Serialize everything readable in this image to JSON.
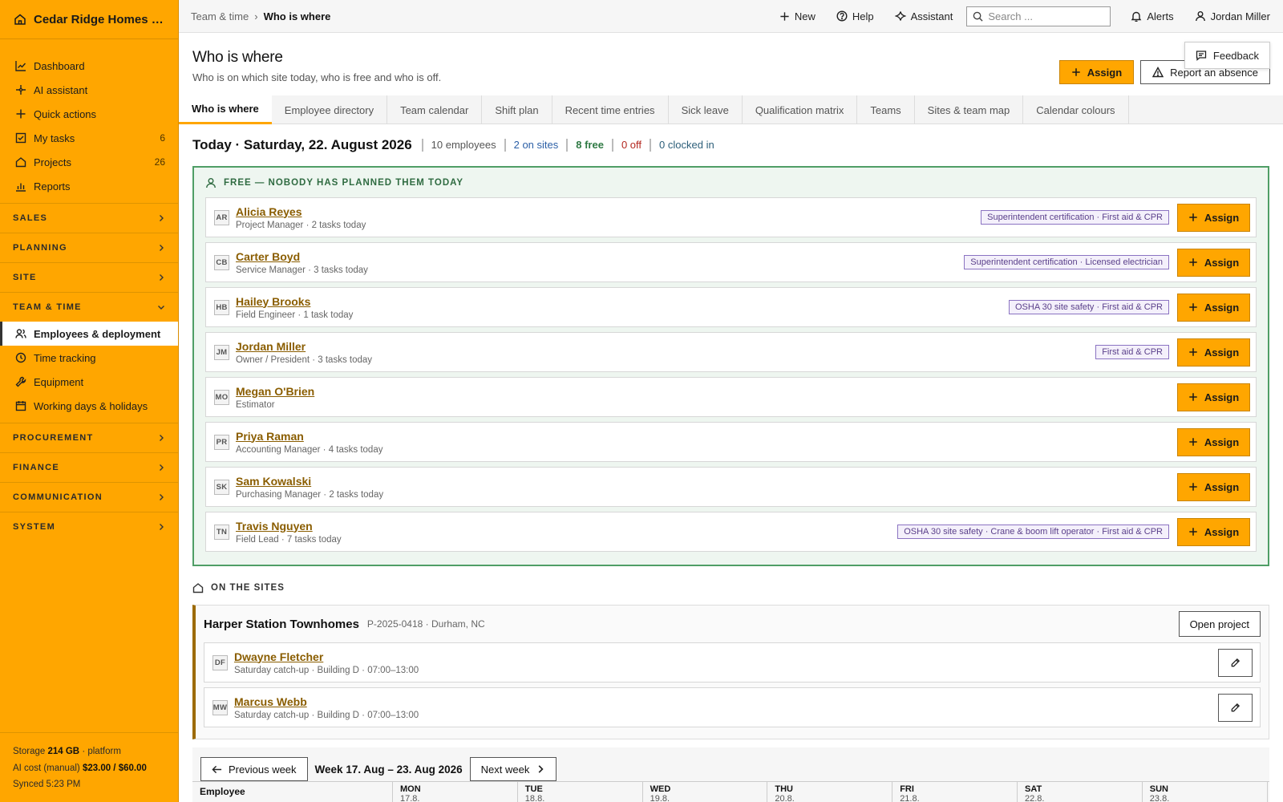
{
  "sidebar": {
    "brand": "Cedar Ridge Homes LLC",
    "items": [
      {
        "label": "Dashboard",
        "icon": "chart-line-icon"
      },
      {
        "label": "AI assistant",
        "icon": "sparkle-icon"
      },
      {
        "label": "Quick actions",
        "icon": "plus-icon"
      },
      {
        "label": "My tasks",
        "icon": "checkbox-icon",
        "count": "6"
      },
      {
        "label": "Projects",
        "icon": "home-icon",
        "count": "26"
      },
      {
        "label": "Reports",
        "icon": "bar-chart-icon"
      }
    ],
    "sections_top": [
      "SALES",
      "PLANNING",
      "SITE"
    ],
    "team_section": "TEAM & TIME",
    "team_items": [
      {
        "label": "Employees & deployment",
        "icon": "users-icon",
        "active": true
      },
      {
        "label": "Time tracking",
        "icon": "clock-icon"
      },
      {
        "label": "Equipment",
        "icon": "wrench-icon"
      },
      {
        "label": "Working days & holidays",
        "icon": "calendar-icon"
      }
    ],
    "sections_bottom": [
      "PROCUREMENT",
      "FINANCE",
      "COMMUNICATION",
      "SYSTEM"
    ],
    "footer": {
      "storage_label": "Storage",
      "storage_value": "214 GB",
      "storage_suffix": "· platform",
      "ai_label": "AI cost (manual)",
      "ai_value": "$23.00 / $60.00",
      "synced": "Synced 5:23 PM"
    }
  },
  "topbar": {
    "breadcrumb_parent": "Team & time",
    "breadcrumb_sep": "›",
    "breadcrumb_current": "Who is where",
    "new_label": "New",
    "help_label": "Help",
    "assistant_label": "Assistant",
    "search_placeholder": "Search ...",
    "alerts_label": "Alerts",
    "user_name": "Jordan Miller"
  },
  "page": {
    "title": "Who is where",
    "subtitle": "Who is on which site today, who is free and who is off.",
    "assign_label": "Assign",
    "report_absence_label": "Report an absence",
    "feedback_label": "Feedback"
  },
  "tabs": [
    "Who is where",
    "Employee directory",
    "Team calendar",
    "Shift plan",
    "Recent time entries",
    "Sick leave",
    "Qualification matrix",
    "Teams",
    "Sites & team map",
    "Calendar colours"
  ],
  "today": {
    "title": "Today · Saturday, 22. August 2026",
    "employees": "10 employees",
    "on_sites": "2 on sites",
    "free": "8 free",
    "off": "0 off",
    "clocked_in": "0 clocked in",
    "colors": {
      "on_sites": "#2b5fa6",
      "free": "#2f7a44",
      "off": "#b3261e",
      "clocked_in": "#2d5f7a"
    }
  },
  "free_section": {
    "heading": "FREE — NOBODY HAS PLANNED THEM TODAY",
    "assign_label": "Assign",
    "people": [
      {
        "initials": "AR",
        "name": "Alicia Reyes",
        "meta": "Project Manager · 2 tasks today",
        "quals": "Superintendent certification · First aid & CPR"
      },
      {
        "initials": "CB",
        "name": "Carter Boyd",
        "meta": "Service Manager · 3 tasks today",
        "quals": "Superintendent certification · Licensed electrician"
      },
      {
        "initials": "HB",
        "name": "Hailey Brooks",
        "meta": "Field Engineer · 1 task today",
        "quals": "OSHA 30 site safety · First aid & CPR"
      },
      {
        "initials": "JM",
        "name": "Jordan Miller",
        "meta": "Owner / President · 3 tasks today",
        "quals": "First aid & CPR"
      },
      {
        "initials": "MO",
        "name": "Megan O'Brien",
        "meta": "Estimator",
        "quals": ""
      },
      {
        "initials": "PR",
        "name": "Priya Raman",
        "meta": "Accounting Manager · 4 tasks today",
        "quals": ""
      },
      {
        "initials": "SK",
        "name": "Sam Kowalski",
        "meta": "Purchasing Manager · 2 tasks today",
        "quals": ""
      },
      {
        "initials": "TN",
        "name": "Travis Nguyen",
        "meta": "Field Lead · 7 tasks today",
        "quals": "OSHA 30 site safety · Crane & boom lift operator · First aid & CPR"
      }
    ]
  },
  "sites_section": {
    "heading": "ON THE SITES",
    "site": {
      "name": "Harper Station Townhomes",
      "meta": "P-2025-0418 · Durham, NC",
      "open_label": "Open project",
      "workers": [
        {
          "initials": "DF",
          "name": "Dwayne Fletcher",
          "meta": "Saturday catch-up · Building D · 07:00–13:00"
        },
        {
          "initials": "MW",
          "name": "Marcus Webb",
          "meta": "Saturday catch-up · Building D · 07:00–13:00"
        }
      ]
    }
  },
  "week": {
    "prev_label": "Previous week",
    "label": "Week 17. Aug – 23. Aug 2026",
    "next_label": "Next week",
    "employee_col": "Employee",
    "days": [
      {
        "day": "MON",
        "date": "17.8."
      },
      {
        "day": "TUE",
        "date": "18.8."
      },
      {
        "day": "WED",
        "date": "19.8."
      },
      {
        "day": "THU",
        "date": "20.8."
      },
      {
        "day": "FRI",
        "date": "21.8."
      },
      {
        "day": "SAT",
        "date": "22.8."
      },
      {
        "day": "SUN",
        "date": "23.8."
      }
    ]
  }
}
